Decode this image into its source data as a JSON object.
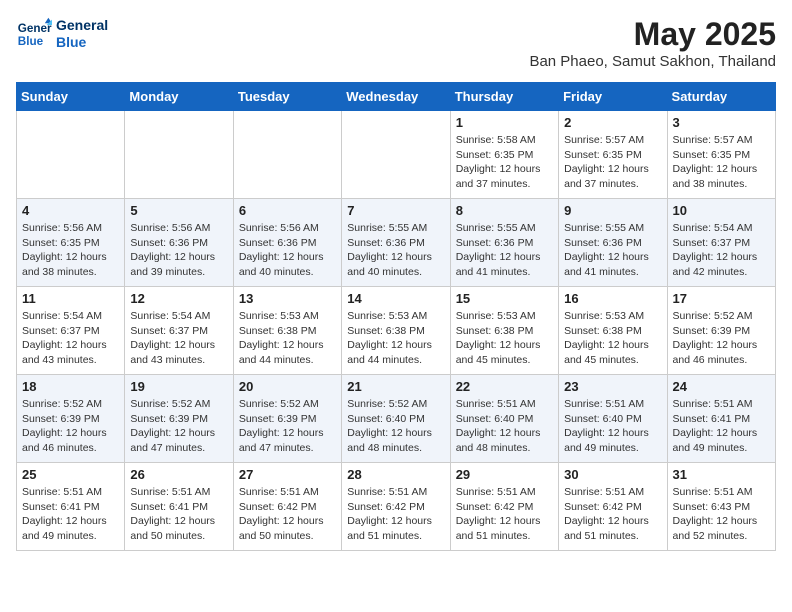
{
  "header": {
    "logo_line1": "General",
    "logo_line2": "Blue",
    "month_year": "May 2025",
    "location": "Ban Phaeo, Samut Sakhon, Thailand"
  },
  "weekdays": [
    "Sunday",
    "Monday",
    "Tuesday",
    "Wednesday",
    "Thursday",
    "Friday",
    "Saturday"
  ],
  "weeks": [
    [
      {
        "day": "",
        "text": ""
      },
      {
        "day": "",
        "text": ""
      },
      {
        "day": "",
        "text": ""
      },
      {
        "day": "",
        "text": ""
      },
      {
        "day": "1",
        "text": "Sunrise: 5:58 AM\nSunset: 6:35 PM\nDaylight: 12 hours\nand 37 minutes."
      },
      {
        "day": "2",
        "text": "Sunrise: 5:57 AM\nSunset: 6:35 PM\nDaylight: 12 hours\nand 37 minutes."
      },
      {
        "day": "3",
        "text": "Sunrise: 5:57 AM\nSunset: 6:35 PM\nDaylight: 12 hours\nand 38 minutes."
      }
    ],
    [
      {
        "day": "4",
        "text": "Sunrise: 5:56 AM\nSunset: 6:35 PM\nDaylight: 12 hours\nand 38 minutes."
      },
      {
        "day": "5",
        "text": "Sunrise: 5:56 AM\nSunset: 6:36 PM\nDaylight: 12 hours\nand 39 minutes."
      },
      {
        "day": "6",
        "text": "Sunrise: 5:56 AM\nSunset: 6:36 PM\nDaylight: 12 hours\nand 40 minutes."
      },
      {
        "day": "7",
        "text": "Sunrise: 5:55 AM\nSunset: 6:36 PM\nDaylight: 12 hours\nand 40 minutes."
      },
      {
        "day": "8",
        "text": "Sunrise: 5:55 AM\nSunset: 6:36 PM\nDaylight: 12 hours\nand 41 minutes."
      },
      {
        "day": "9",
        "text": "Sunrise: 5:55 AM\nSunset: 6:36 PM\nDaylight: 12 hours\nand 41 minutes."
      },
      {
        "day": "10",
        "text": "Sunrise: 5:54 AM\nSunset: 6:37 PM\nDaylight: 12 hours\nand 42 minutes."
      }
    ],
    [
      {
        "day": "11",
        "text": "Sunrise: 5:54 AM\nSunset: 6:37 PM\nDaylight: 12 hours\nand 43 minutes."
      },
      {
        "day": "12",
        "text": "Sunrise: 5:54 AM\nSunset: 6:37 PM\nDaylight: 12 hours\nand 43 minutes."
      },
      {
        "day": "13",
        "text": "Sunrise: 5:53 AM\nSunset: 6:38 PM\nDaylight: 12 hours\nand 44 minutes."
      },
      {
        "day": "14",
        "text": "Sunrise: 5:53 AM\nSunset: 6:38 PM\nDaylight: 12 hours\nand 44 minutes."
      },
      {
        "day": "15",
        "text": "Sunrise: 5:53 AM\nSunset: 6:38 PM\nDaylight: 12 hours\nand 45 minutes."
      },
      {
        "day": "16",
        "text": "Sunrise: 5:53 AM\nSunset: 6:38 PM\nDaylight: 12 hours\nand 45 minutes."
      },
      {
        "day": "17",
        "text": "Sunrise: 5:52 AM\nSunset: 6:39 PM\nDaylight: 12 hours\nand 46 minutes."
      }
    ],
    [
      {
        "day": "18",
        "text": "Sunrise: 5:52 AM\nSunset: 6:39 PM\nDaylight: 12 hours\nand 46 minutes."
      },
      {
        "day": "19",
        "text": "Sunrise: 5:52 AM\nSunset: 6:39 PM\nDaylight: 12 hours\nand 47 minutes."
      },
      {
        "day": "20",
        "text": "Sunrise: 5:52 AM\nSunset: 6:39 PM\nDaylight: 12 hours\nand 47 minutes."
      },
      {
        "day": "21",
        "text": "Sunrise: 5:52 AM\nSunset: 6:40 PM\nDaylight: 12 hours\nand 48 minutes."
      },
      {
        "day": "22",
        "text": "Sunrise: 5:51 AM\nSunset: 6:40 PM\nDaylight: 12 hours\nand 48 minutes."
      },
      {
        "day": "23",
        "text": "Sunrise: 5:51 AM\nSunset: 6:40 PM\nDaylight: 12 hours\nand 49 minutes."
      },
      {
        "day": "24",
        "text": "Sunrise: 5:51 AM\nSunset: 6:41 PM\nDaylight: 12 hours\nand 49 minutes."
      }
    ],
    [
      {
        "day": "25",
        "text": "Sunrise: 5:51 AM\nSunset: 6:41 PM\nDaylight: 12 hours\nand 49 minutes."
      },
      {
        "day": "26",
        "text": "Sunrise: 5:51 AM\nSunset: 6:41 PM\nDaylight: 12 hours\nand 50 minutes."
      },
      {
        "day": "27",
        "text": "Sunrise: 5:51 AM\nSunset: 6:42 PM\nDaylight: 12 hours\nand 50 minutes."
      },
      {
        "day": "28",
        "text": "Sunrise: 5:51 AM\nSunset: 6:42 PM\nDaylight: 12 hours\nand 51 minutes."
      },
      {
        "day": "29",
        "text": "Sunrise: 5:51 AM\nSunset: 6:42 PM\nDaylight: 12 hours\nand 51 minutes."
      },
      {
        "day": "30",
        "text": "Sunrise: 5:51 AM\nSunset: 6:42 PM\nDaylight: 12 hours\nand 51 minutes."
      },
      {
        "day": "31",
        "text": "Sunrise: 5:51 AM\nSunset: 6:43 PM\nDaylight: 12 hours\nand 52 minutes."
      }
    ]
  ]
}
